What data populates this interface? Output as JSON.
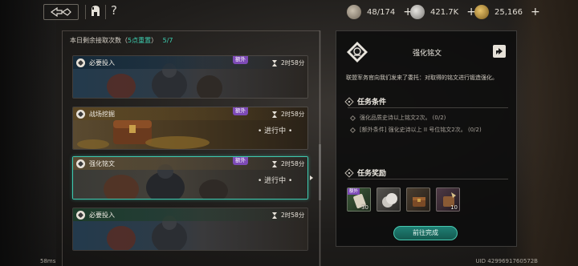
{
  "topbar": {
    "help_label": "?",
    "resources": [
      {
        "icon": "crest-coin-icon",
        "value": "48/174",
        "color": "#9a8f7e"
      },
      {
        "icon": "silver-coin-icon",
        "value": "421.7K",
        "color": "#b8b5b0"
      },
      {
        "icon": "gold-coin-icon",
        "value": "25,166",
        "color": "#b08a3a"
      }
    ],
    "plus": "+"
  },
  "left": {
    "attempts_prefix": "本日剩余接取次数（",
    "attempts_reset": "5点重置",
    "attempts_suffix": "）",
    "attempts_count": "5/7",
    "cards": [
      {
        "title": "必要投入",
        "extra": "额外",
        "timer": "2时58分",
        "status": ""
      },
      {
        "title": "战场挖掘",
        "extra": "额外",
        "timer": "2时58分",
        "status": "• 进行中 •"
      },
      {
        "title": "强化铭文",
        "extra": "额外",
        "timer": "2时58分",
        "status": "• 进行中 •"
      },
      {
        "title": "必要投入",
        "extra": "",
        "timer": "2时58分",
        "status": ""
      }
    ]
  },
  "detail": {
    "title": "强化铭文",
    "description": "联盟军务官向我们发来了委托：对取得的铭文进行锻造强化。",
    "conditions_heading": "任务条件",
    "conditions": [
      "强化品质史诗以上铭文2次。 (0/2)",
      "[额外条件] 强化史诗以上 II 号位铭文2次。 (0/2)"
    ],
    "rewards_heading": "任务奖励",
    "rewards": [
      {
        "icon": "scroll-icon",
        "count": "30",
        "tag": "额外"
      },
      {
        "icon": "silver-coins-icon",
        "count": "",
        "tag": ""
      },
      {
        "icon": "chest-icon",
        "count": "",
        "tag": ""
      },
      {
        "icon": "crafting-box-icon",
        "count": "10",
        "tag": ""
      }
    ],
    "go_button": "前往完成"
  },
  "footer": {
    "ping": "58ms",
    "uid": "UID 4299691760572B"
  }
}
